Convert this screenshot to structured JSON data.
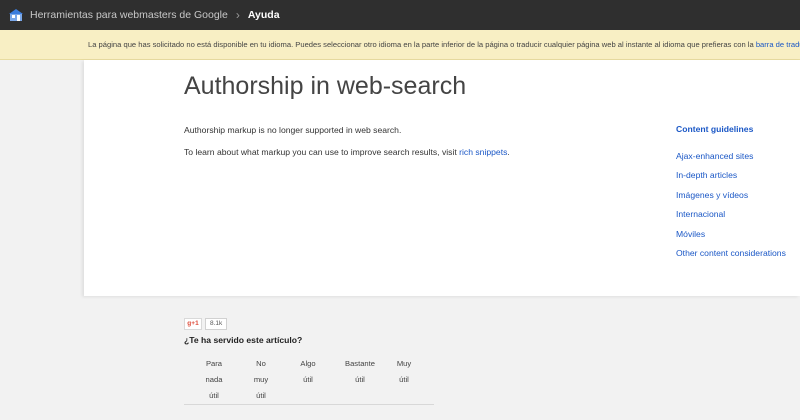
{
  "topbar": {
    "app_name": "Herramientas para webmasters de Google",
    "current": "Ayuda"
  },
  "notice": {
    "text": "La página que has solicitado no está disponible en tu idioma. Puedes seleccionar otro idioma en la parte inferior de la página o traducir cualquier página web al instante al idioma que prefieras con la ",
    "link": "barra de traducción inte"
  },
  "article": {
    "title": "Authorship in web-search",
    "p1": "Authorship markup is no longer supported in web search.",
    "p2_prefix": "To learn about what markup you can use to improve search results, visit ",
    "p2_link": "rich snippets",
    "p2_suffix": "."
  },
  "guidelines": {
    "heading": "Content guidelines",
    "items": [
      "Ajax-enhanced sites",
      "In-depth articles",
      "Imágenes y vídeos",
      "Internacional",
      "Móviles",
      "Other content considerations"
    ]
  },
  "feedback": {
    "gplus_label": "g+1",
    "gplus_count": "8.1k",
    "question": "¿Te ha servido este artículo?",
    "ratings": [
      [
        "Para",
        "nada",
        "útil"
      ],
      [
        "No",
        "muy",
        "útil"
      ],
      [
        "Algo",
        "útil"
      ],
      [
        "Bastante",
        "útil"
      ],
      [
        "Muy",
        "útil"
      ]
    ]
  }
}
